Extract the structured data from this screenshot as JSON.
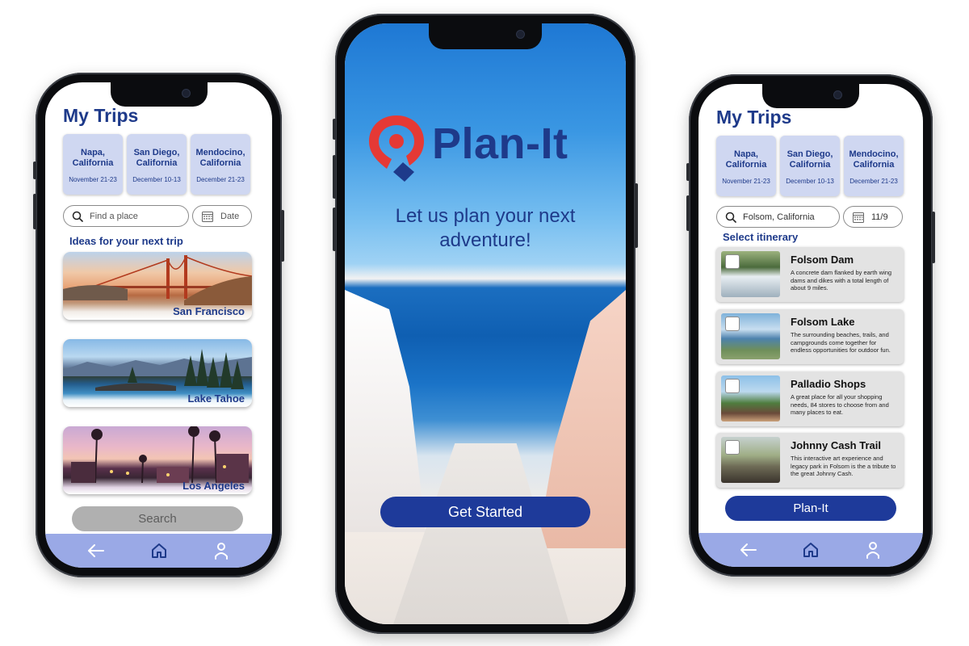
{
  "colors": {
    "brand_blue": "#1e3a8a",
    "button_blue": "#1e3a9a",
    "card_lavender": "#cfd7f1",
    "nav_periwinkle": "#9aa9e6",
    "search_disabled_gray": "#b0b0b0",
    "logo_red": "#e53935"
  },
  "left_screen": {
    "title": "My Trips",
    "trips": [
      {
        "name": "Napa, California",
        "dates": "November 21-23"
      },
      {
        "name": "San Diego, California",
        "dates": "December 10-13"
      },
      {
        "name": "Mendocino, California",
        "dates": "December 21-23"
      }
    ],
    "search_placeholder": "Find a place",
    "date_placeholder": "Date",
    "ideas_title": "Ideas for your next trip",
    "ideas": [
      {
        "label": "San Francisco"
      },
      {
        "label": "Lake Tahoe"
      },
      {
        "label": "Los Angeles"
      }
    ],
    "search_button": "Search",
    "nav_icons": [
      "back-arrow-icon",
      "home-icon",
      "profile-icon"
    ]
  },
  "middle_screen": {
    "brand_name": "Plan-It",
    "tagline": "Let us plan your next adventure!",
    "cta_button": "Get Started"
  },
  "right_screen": {
    "title": "My Trips",
    "trips": [
      {
        "name": "Napa, California",
        "dates": "November 21-23"
      },
      {
        "name": "San Diego, California",
        "dates": "December 10-13"
      },
      {
        "name": "Mendocino, California",
        "dates": "December 21-23"
      }
    ],
    "search_value": "Folsom, California",
    "date_value": "11/9",
    "section_title": "Select itinerary",
    "itinerary": [
      {
        "title": "Folsom Dam",
        "description": "A concrete dam flanked by earth wing dams and dikes with a total length of about 9 miles.",
        "checked": false
      },
      {
        "title": "Folsom Lake",
        "description": "The surrounding beaches, trails, and campgrounds come together for endless opportunities for outdoor fun.",
        "checked": false
      },
      {
        "title": "Palladio Shops",
        "description": "A great place for all your shopping needs, 84 stores to choose from and many places to eat.",
        "checked": false
      },
      {
        "title": "Johnny Cash Trail",
        "description": "This interactive art experience and legacy park in Folsom is the a tribute to the great Johnny Cash.",
        "checked": false
      }
    ],
    "plan_button": "Plan-It",
    "nav_icons": [
      "back-arrow-icon",
      "home-icon",
      "profile-icon"
    ]
  }
}
